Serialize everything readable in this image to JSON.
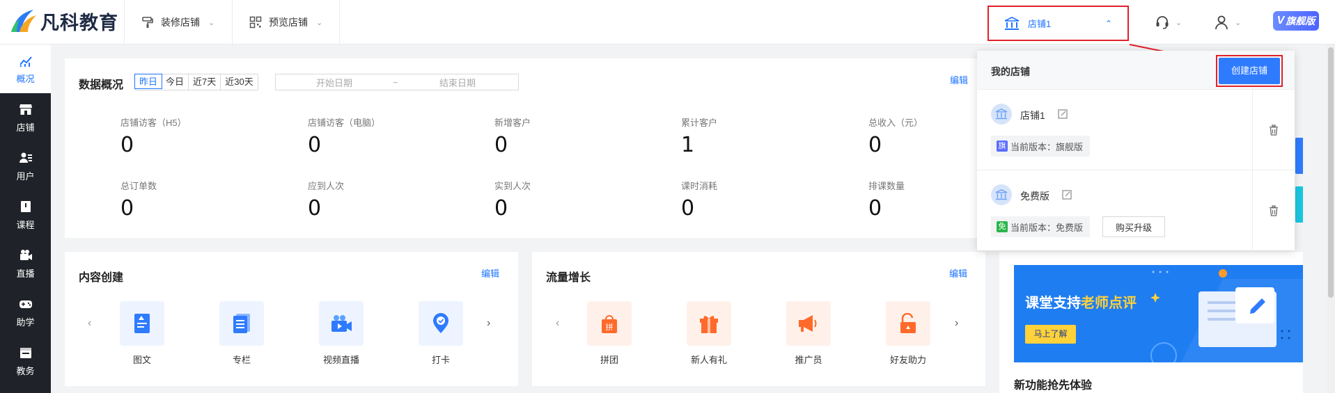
{
  "brand": {
    "name": "凡科教育"
  },
  "topbar": {
    "decorate_store": "装修店铺",
    "preview_store": "预览店铺",
    "current_store": "店铺1",
    "vip_label": "旗舰版"
  },
  "sidebar": {
    "items": [
      {
        "label": "概况",
        "icon": "chart-icon"
      },
      {
        "label": "店铺",
        "icon": "shop-icon"
      },
      {
        "label": "用户",
        "icon": "users-icon"
      },
      {
        "label": "课程",
        "icon": "book-icon"
      },
      {
        "label": "直播",
        "icon": "video-icon"
      },
      {
        "label": "助学",
        "icon": "gamepad-icon"
      },
      {
        "label": "教务",
        "icon": "calendar-icon"
      }
    ]
  },
  "overview": {
    "title": "数据概况",
    "edit": "编辑",
    "ranges": [
      "昨日",
      "今日",
      "近7天",
      "近30天"
    ],
    "start_placeholder": "开始日期",
    "separator": "~",
    "end_placeholder": "结束日期",
    "metrics": [
      {
        "label": "店铺访客（H5）",
        "value": "0"
      },
      {
        "label": "店铺访客（电脑）",
        "value": "0"
      },
      {
        "label": "新增客户",
        "value": "0"
      },
      {
        "label": "累计客户",
        "value": "1"
      },
      {
        "label": "总收入（元）",
        "value": "0"
      },
      {
        "label": "总订单数",
        "value": "0"
      },
      {
        "label": "应到人次",
        "value": "0"
      },
      {
        "label": "实到人次",
        "value": "0"
      },
      {
        "label": "课时消耗",
        "value": "0"
      },
      {
        "label": "排课数量",
        "value": "0"
      }
    ]
  },
  "content_creation": {
    "title": "内容创建",
    "edit": "编辑",
    "tiles": [
      {
        "label": "图文",
        "icon": "article-icon"
      },
      {
        "label": "专栏",
        "icon": "column-icon"
      },
      {
        "label": "视频直播",
        "icon": "video-live-icon"
      },
      {
        "label": "打卡",
        "icon": "checkin-icon"
      }
    ]
  },
  "traffic_growth": {
    "title": "流量增长",
    "edit": "编辑",
    "tiles": [
      {
        "label": "拼团",
        "icon": "group-buy-icon"
      },
      {
        "label": "新人有礼",
        "icon": "gift-icon"
      },
      {
        "label": "推广员",
        "icon": "megaphone-icon"
      },
      {
        "label": "好友助力",
        "icon": "unlock-icon"
      }
    ]
  },
  "store_dropdown": {
    "title": "我的店铺",
    "create_button": "创建店铺",
    "stores": [
      {
        "name": "店铺1",
        "version_text": "当前版本：旗舰版",
        "badge": "旗",
        "badge_color": "#5b6cff"
      },
      {
        "name": "免费版",
        "version_text": "当前版本：免费版",
        "badge": "免",
        "badge_color": "#2bb64b",
        "upgrade": "购买升级"
      }
    ]
  },
  "banner": {
    "title_pre": "课堂支持",
    "title_hl": "老师点评",
    "button": "马上了解"
  },
  "new_feature_title": "新功能抢先体验",
  "colors": {
    "accent": "#1e74ff",
    "sidebar_bg": "#1f2228",
    "highlight_red": "#e0202a"
  }
}
